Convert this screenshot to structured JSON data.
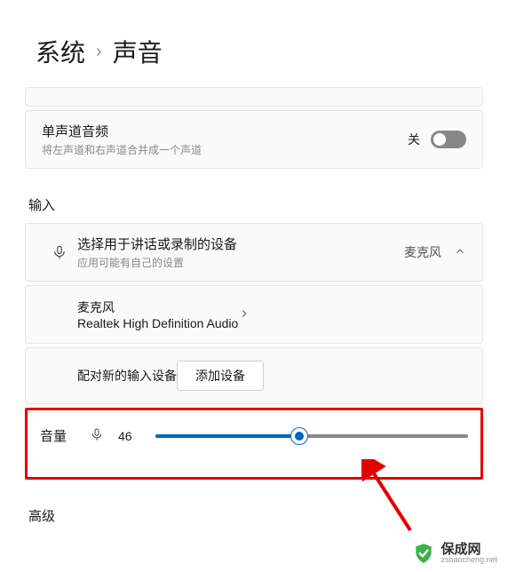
{
  "breadcrumb": {
    "parent": "系统",
    "sep": "›",
    "current": "声音"
  },
  "mono_audio": {
    "title": "单声道音频",
    "subtitle": "将左声道和右声道合并成一个声道",
    "state_label": "关"
  },
  "input_section_label": "输入",
  "input_device": {
    "title": "选择用于讲话或录制的设备",
    "subtitle": "应用可能有自己的设置",
    "selected": "麦克风"
  },
  "mic_device": {
    "title": "麦克风",
    "subtitle": "Realtek High Definition Audio"
  },
  "pair_device": {
    "title": "配对新的输入设备",
    "button": "添加设备"
  },
  "volume": {
    "label": "音量",
    "value": "46",
    "percent": 46
  },
  "advanced_label": "高级",
  "watermark": {
    "name": "保成网",
    "domain": "zsbaocheng.net"
  }
}
